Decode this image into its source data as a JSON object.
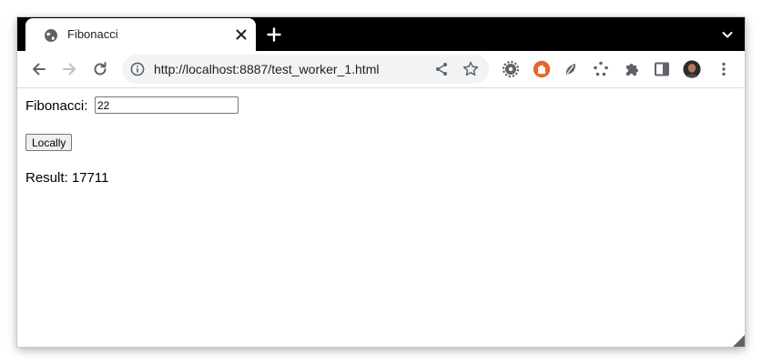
{
  "tab": {
    "title": "Fibonacci",
    "favicon": "globe-icon",
    "close": "close-icon"
  },
  "tabbar": {
    "new_tab": "plus-icon",
    "menu": "chevron-down-icon"
  },
  "toolbar": {
    "url": "http://localhost:8887/test_worker_1.html",
    "extensions": [
      "gear-extension-icon",
      "hand-extension-icon",
      "leaf-extension-icon",
      "dots-extension-icon",
      "puzzle-icon",
      "side-panel-icon",
      "avatar",
      "kebab-menu-icon"
    ]
  },
  "page": {
    "fib_label": "Fibonacci:",
    "fib_value": "22",
    "button_label": "Locally",
    "result_text": "Result: 17711"
  },
  "colors": {
    "tabbar": "#000000",
    "omnibox": "#f1f3f4",
    "accent_orange": "#e8652b"
  }
}
